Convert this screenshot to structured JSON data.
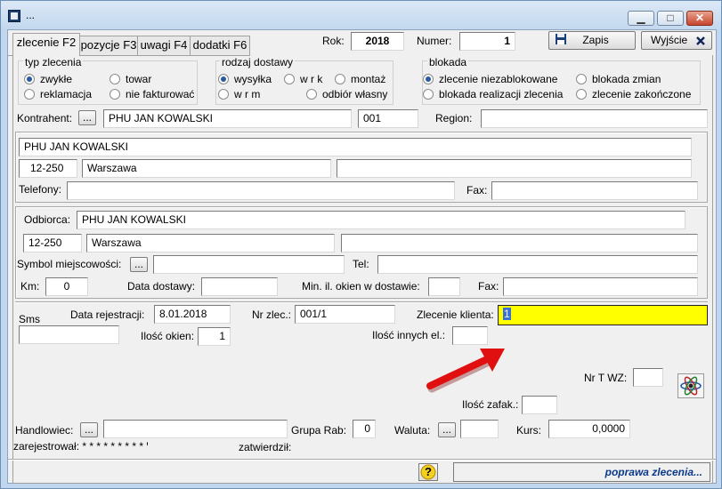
{
  "window": {
    "title": "...",
    "minimize": "▁",
    "maximize": "□",
    "close": "✕"
  },
  "tabs": [
    {
      "label": "zlecenie F2"
    },
    {
      "label": "pozycje F3"
    },
    {
      "label": "uwagi F4"
    },
    {
      "label": "dodatki F6"
    }
  ],
  "header": {
    "rok_label": "Rok:",
    "rok_value": "2018",
    "numer_label": "Numer:",
    "numer_value": "1",
    "save_label": "Zapis",
    "exit_label": "Wyjście"
  },
  "typ": {
    "title": "typ zlecenia",
    "options": [
      {
        "label": "zwykłe",
        "checked": true
      },
      {
        "label": "towar",
        "checked": false
      },
      {
        "label": "reklamacja",
        "checked": false
      },
      {
        "label": "nie fakturować",
        "checked": false
      }
    ]
  },
  "dostawa": {
    "title": "rodzaj dostawy",
    "options": [
      {
        "label": "wysyłka",
        "checked": true
      },
      {
        "label": "w r k",
        "checked": false
      },
      {
        "label": "montaż",
        "checked": false
      },
      {
        "label": "w r m",
        "checked": false
      },
      {
        "label": "odbiór własny",
        "checked": false
      }
    ]
  },
  "blokada": {
    "title": "blokada",
    "options": [
      {
        "label": "zlecenie niezablokowane",
        "checked": true
      },
      {
        "label": "blokada zmian",
        "checked": false
      },
      {
        "label": "blokada realizacji zlecenia",
        "checked": false
      },
      {
        "label": "zlecenie zakończone",
        "checked": false
      }
    ]
  },
  "kontrahent": {
    "label": "Kontrahent:",
    "browse": "...",
    "name": "PHU JAN KOWALSKI",
    "code": "001",
    "region_label": "Region:",
    "region": ""
  },
  "address": {
    "name": "PHU JAN KOWALSKI",
    "zip": "12-250",
    "city": "Warszawa",
    "street": "",
    "phone_label": "Telefony:",
    "phone": "",
    "fax_label": "Fax:",
    "fax": ""
  },
  "odbiorca": {
    "label": "Odbiorca:",
    "name": "PHU JAN KOWALSKI",
    "zip": "12-250",
    "city": "Warszawa",
    "street": "",
    "symbol_label": "Symbol miejscowości:",
    "symbol_browse": "...",
    "symbol": "",
    "tel_label": "Tel:",
    "tel": "",
    "km_label": "Km:",
    "km": "0",
    "data_label": "Data dostawy:",
    "data": "",
    "min_label": "Min. il. okien w dostawie:",
    "min": "",
    "fax_label": "Fax:",
    "fax": ""
  },
  "order": {
    "sms_label": "Sms",
    "sms": "",
    "data_rej_label": "Data rejestracji:",
    "data_rej": "8.01.2018",
    "nrzlec_label": "Nr zlec.:",
    "nrzlec": "001/1",
    "klienta_label": "Zlecenie klienta:",
    "klienta": "1",
    "ilosc_okien_label": "Ilość okien:",
    "ilosc_okien": "1",
    "ilosc_innych_label": "Ilość innych el.:",
    "ilosc_innych": "",
    "nrtwz_label": "Nr T WZ:",
    "nrtwz": "",
    "zafak_label": "Ilość zafak.:",
    "zafak": ""
  },
  "footer": {
    "handlowiec_label": "Handlowiec:",
    "handlowiec_browse": "...",
    "handlowiec": "",
    "grupa_label": "Grupa Rab:",
    "grupa": "0",
    "waluta_label": "Waluta:",
    "waluta_browse": "...",
    "waluta": "",
    "kurs_label": "Kurs:",
    "kurs": "0,0000",
    "zarejestrowal": "zarejestrował: * * * * * * * * * ꞌ",
    "zatwierdzil": "zatwierdził:",
    "help": "?",
    "status": "poprawa zlecenia..."
  },
  "colors": {
    "highlight": "#ffff00",
    "arrow": "#e01010",
    "status_text": "#0c3a8a"
  }
}
